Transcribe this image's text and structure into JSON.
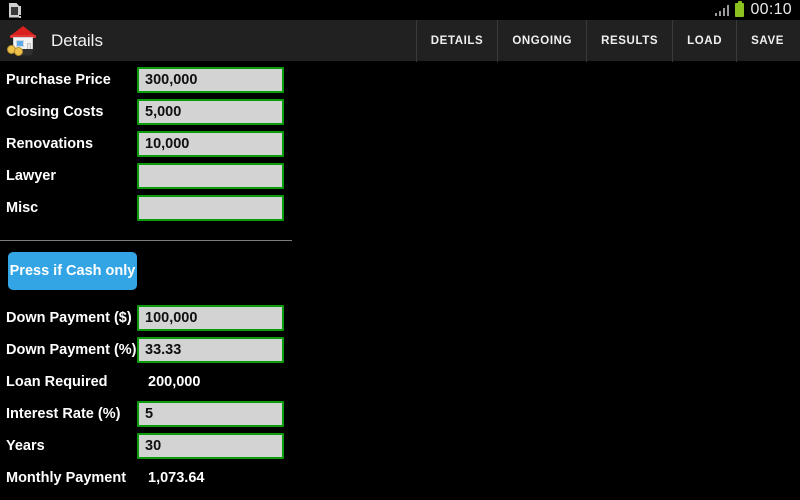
{
  "status_bar": {
    "storage_icon": "sd-card-warning-icon",
    "signal_icon": "signal-bars-icon",
    "battery_icon": "battery-full-icon",
    "battery_color": "#8bc220",
    "clock": "00:10"
  },
  "action_bar": {
    "app_icon": "house-with-coins-icon",
    "title": "Details",
    "background": "#212121",
    "menu": [
      {
        "label": "DETAILS",
        "name": "menu-item-details"
      },
      {
        "label": "ONGOING",
        "name": "menu-item-ongoing"
      },
      {
        "label": "RESULTS",
        "name": "menu-item-results"
      },
      {
        "label": "LOAD",
        "name": "menu-item-load"
      },
      {
        "label": "SAVE",
        "name": "menu-item-save"
      }
    ]
  },
  "form": {
    "field_border_color": "#0a9c0a",
    "field_fill_color": "#d3d3d3",
    "upper_rows": [
      {
        "label": "Purchase Price",
        "value": "300,000",
        "type": "input"
      },
      {
        "label": "Closing Costs",
        "value": "5,000",
        "type": "input"
      },
      {
        "label": "Renovations",
        "value": "10,000",
        "type": "input"
      },
      {
        "label": "Lawyer",
        "value": "",
        "type": "input"
      },
      {
        "label": "Misc",
        "value": "",
        "type": "input"
      }
    ],
    "cash_button": {
      "label": "Press if Cash only",
      "color": "#33a5e5"
    },
    "lower_rows": [
      {
        "label": "Down Payment ($)",
        "value": "100,000",
        "type": "input"
      },
      {
        "label": "Down Payment (%)",
        "value": "33.33",
        "type": "input"
      },
      {
        "label": "Loan Required",
        "value": "200,000",
        "type": "readonly"
      },
      {
        "label": "Interest Rate (%)",
        "value": "5",
        "type": "input"
      },
      {
        "label": "Years",
        "value": "30",
        "type": "input"
      },
      {
        "label": "Monthly Payment",
        "value": "1,073.64",
        "type": "readonly"
      }
    ]
  }
}
